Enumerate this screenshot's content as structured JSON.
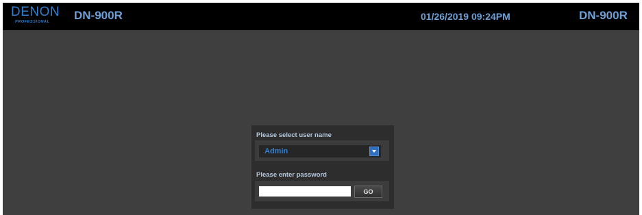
{
  "header": {
    "logo_brand": "DENON",
    "logo_tagline": "PROFESSIONAL",
    "model_left": "DN-900R",
    "datetime": "01/26/2019 09:24PM",
    "model_right": "DN-900R"
  },
  "login": {
    "user_label": "Please select user name",
    "user_selected": "Admin",
    "password_label": "Please enter password",
    "password_value": "",
    "go_label": "GO"
  },
  "icons": {
    "dropdown": "chevron-down-icon"
  },
  "colors": {
    "header_bg": "#000000",
    "page_bg": "#3f3f3f",
    "panel_bg": "#2d2d2d",
    "accent_blue": "#2f7fd0",
    "header_text": "#6ea0d6"
  }
}
